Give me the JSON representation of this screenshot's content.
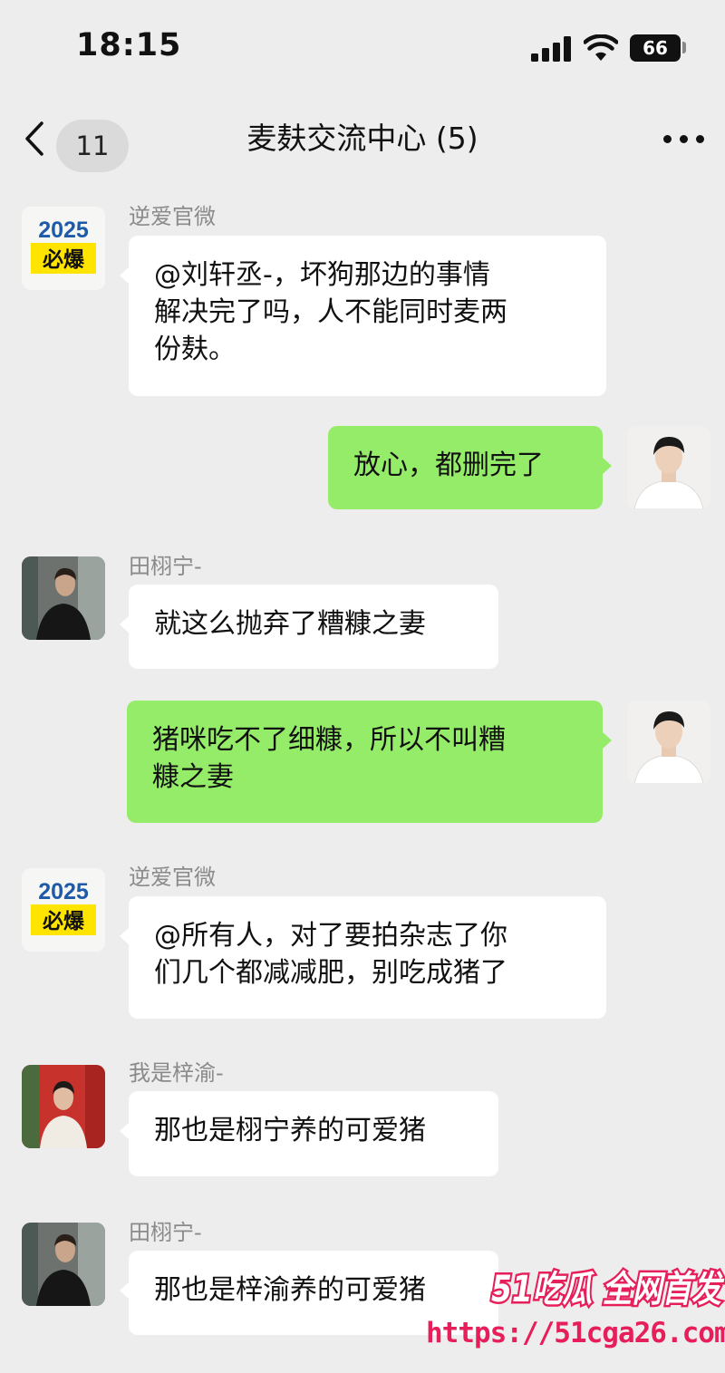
{
  "status_bar": {
    "time": "18:15",
    "battery": "66"
  },
  "nav": {
    "back_count": "11",
    "title": "麦麸交流中心 (5)"
  },
  "icons": {
    "logo_year": "2025",
    "logo_text": "必爆"
  },
  "messages": [
    {
      "sender": "逆爱官微",
      "text": "@刘轩丞-，坏狗那边的事情\n解决完了吗，人不能同时麦两\n份麸。"
    },
    {
      "sender": "",
      "text": "放心，都删完了"
    },
    {
      "sender": "田栩宁-",
      "text": "就这么抛弃了糟糠之妻"
    },
    {
      "sender": "",
      "text": "猪咪吃不了细糠，所以不叫糟\n糠之妻"
    },
    {
      "sender": "逆爱官微",
      "text": "@所有人，对了要拍杂志了你\n们几个都减减肥，别吃成猪了"
    },
    {
      "sender": "我是梓渝-",
      "text": "那也是栩宁养的可爱猪"
    },
    {
      "sender": "田栩宁-",
      "text": "那也是梓渝养的可爱猪"
    }
  ],
  "watermark": {
    "brand": "51吃瓜 全网首发",
    "url": "https://51cga26.com"
  },
  "colors": {
    "background": "#ededed",
    "incoming_bubble": "#ffffff",
    "outgoing_bubble": "#95ec69",
    "watermark": "#e61e5a"
  }
}
